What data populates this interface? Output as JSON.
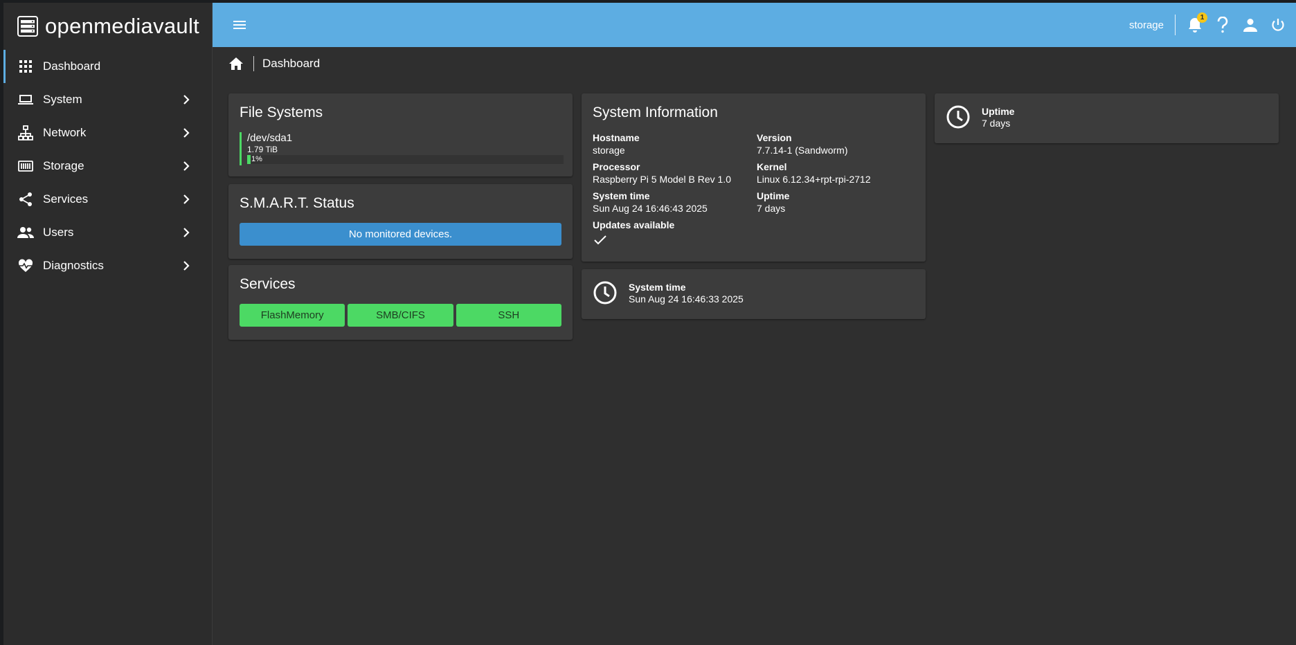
{
  "app": {
    "brand": "openmediavault",
    "hostname": "storage",
    "notification_count": "1",
    "accent_color": "#5dade2"
  },
  "sidebar": {
    "items": [
      {
        "label": "Dashboard",
        "icon": "grid-icon",
        "active": true
      },
      {
        "label": "System",
        "icon": "laptop-icon"
      },
      {
        "label": "Network",
        "icon": "network-icon"
      },
      {
        "label": "Storage",
        "icon": "storage-icon"
      },
      {
        "label": "Services",
        "icon": "share-icon"
      },
      {
        "label": "Users",
        "icon": "users-icon"
      },
      {
        "label": "Diagnostics",
        "icon": "heart-pulse-icon"
      }
    ]
  },
  "breadcrumb": {
    "current": "Dashboard"
  },
  "filesystems": {
    "title": "File Systems",
    "device": "/dev/sda1",
    "size": "1.79 TiB",
    "usage_label": "1%",
    "usage_fraction": 0.01
  },
  "smart": {
    "title": "S.M.A.R.T. Status",
    "message": "No monitored devices."
  },
  "services": {
    "title": "Services",
    "items": [
      "FlashMemory",
      "SMB/CIFS",
      "SSH"
    ],
    "status_color": "#4cd964"
  },
  "sysinfo": {
    "title": "System Information",
    "hostname_label": "Hostname",
    "hostname_value": "storage",
    "version_label": "Version",
    "version_value": "7.7.14-1 (Sandworm)",
    "processor_label": "Processor",
    "processor_value": "Raspberry Pi 5 Model B Rev 1.0",
    "kernel_label": "Kernel",
    "kernel_value": "Linux 6.12.34+rpt-rpi-2712",
    "systime_label": "System time",
    "systime_value": "Sun Aug 24 16:46:43 2025",
    "uptime_label": "Uptime",
    "uptime_value": "7 days",
    "updates_label": "Updates available"
  },
  "systime_widget": {
    "label": "System time",
    "value": "Sun Aug 24 16:46:33 2025"
  },
  "uptime_widget": {
    "label": "Uptime",
    "value": "7 days"
  }
}
